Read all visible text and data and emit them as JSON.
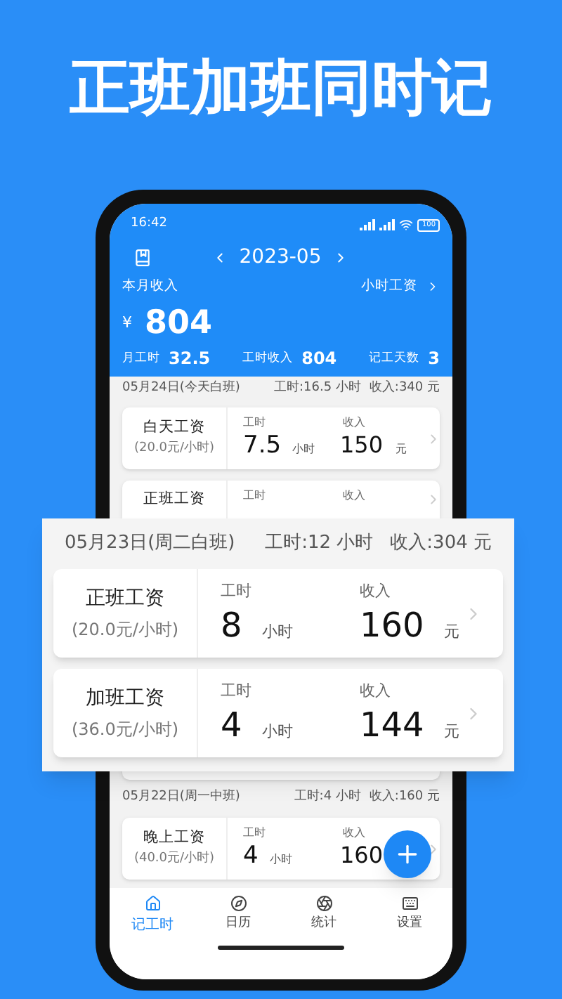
{
  "headline": "正班加班同时记",
  "status_bar": {
    "time": "16:42",
    "battery": "100"
  },
  "header": {
    "month": "2023-05",
    "income_label": "本月收入",
    "rate_link": "小时工资",
    "currency": "¥",
    "income": "804",
    "stats": [
      {
        "label": "月工时",
        "value": "32.5"
      },
      {
        "label": "工时收入",
        "value": "804"
      },
      {
        "label": "记工天数",
        "value": "3"
      }
    ]
  },
  "days": [
    {
      "date": "05月24日(今天白班)",
      "hours": "工时:16.5 小时",
      "income": "收入:340 元",
      "entries": [
        {
          "name": "白天工资",
          "rate": "(20.0元/小时)",
          "hours_label": "工时",
          "hours": "7.5",
          "hours_unit": "小时",
          "income_label": "收入",
          "income": "150",
          "income_unit": "元"
        },
        {
          "name": "正班工资",
          "hours_label": "工时",
          "income_label": "收入"
        }
      ]
    },
    {
      "date": "05月22日(周一中班)",
      "hours": "工时:4 小时",
      "income": "收入:160 元",
      "entries": [
        {
          "name": "晚上工资",
          "rate": "(40.0元/小时)",
          "hours_label": "工时",
          "hours": "4",
          "hours_unit": "小时",
          "income_label": "收入",
          "income": "160"
        }
      ]
    }
  ],
  "zoom_card": {
    "date": "05月23日(周二白班)",
    "hours": "工时:12 小时",
    "income": "收入:304 元",
    "entries": [
      {
        "name": "正班工资",
        "rate": "(20.0元/小时)",
        "hours_label": "工时",
        "hours": "8",
        "hours_unit": "小时",
        "income_label": "收入",
        "income": "160",
        "income_unit": "元"
      },
      {
        "name": "加班工资",
        "rate": "(36.0元/小时)",
        "hours_label": "工时",
        "hours": "4",
        "hours_unit": "小时",
        "income_label": "收入",
        "income": "144",
        "income_unit": "元"
      }
    ]
  },
  "tabs": [
    {
      "label": "记工时",
      "selected": true
    },
    {
      "label": "日历",
      "selected": false
    },
    {
      "label": "统计",
      "selected": false
    },
    {
      "label": "设置",
      "selected": false
    }
  ]
}
